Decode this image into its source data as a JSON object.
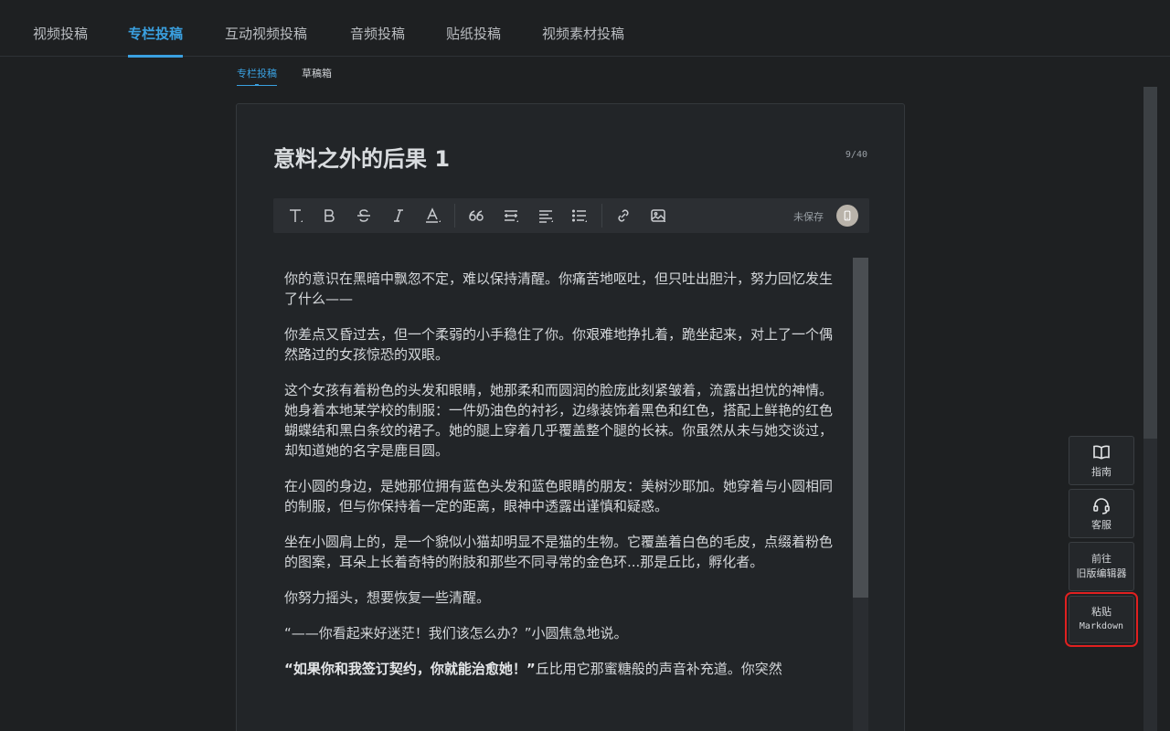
{
  "top_tabs": [
    "视频投稿",
    "专栏投稿",
    "互动视频投稿",
    "音频投稿",
    "贴纸投稿",
    "视频素材投稿"
  ],
  "sub_tabs": [
    "专栏投稿",
    "草稿箱"
  ],
  "editor": {
    "title": "意料之外的后果  1",
    "counter": "9/40",
    "save_status": "未保存"
  },
  "paragraphs": [
    "你的意识在黑暗中飘忽不定，难以保持清醒。你痛苦地呕吐，但只吐出胆汁，努力回忆发生了什么——",
    "你差点又昏过去，但一个柔弱的小手稳住了你。你艰难地挣扎着，跪坐起来，对上了一个偶然路过的女孩惊恐的双眼。",
    "这个女孩有着粉色的头发和眼睛，她那柔和而圆润的脸庞此刻紧皱着，流露出担忧的神情。她身着本地某学校的制服：一件奶油色的衬衫，边缘装饰着黑色和红色，搭配上鲜艳的红色蝴蝶结和黑白条纹的裙子。她的腿上穿着几乎覆盖整个腿的长袜。你虽然从未与她交谈过，却知道她的名字是鹿目圆。",
    "在小圆的身边，是她那位拥有蓝色头发和蓝色眼睛的朋友：美树沙耶加。她穿着与小圆相同的制服，但与你保持着一定的距离，眼神中透露出谨慎和疑惑。",
    "坐在小圆肩上的，是一个貌似小猫却明显不是猫的生物。它覆盖着白色的毛皮，点缀着粉色的图案，耳朵上长着奇特的附肢和那些不同寻常的金色环...那是丘比，孵化者。",
    "你努力摇头，想要恢复一些清醒。",
    "“——你看起来好迷茫！我们该怎么办？”小圆焦急地说。"
  ],
  "last_paragraph": {
    "bold": "“如果你和我签订契约，你就能治愈她！”",
    "rest": "丘比用它那蜜糖般的声音补充道。你突然"
  },
  "side_buttons": {
    "guide": "指南",
    "service": "客服",
    "old_editor_line1": "前往",
    "old_editor_line2": "旧版编辑器",
    "paste_line1": "粘贴",
    "paste_line2": "Markdown"
  },
  "colors": {
    "accent": "#3aa0e0",
    "highlight": "#e02020"
  }
}
